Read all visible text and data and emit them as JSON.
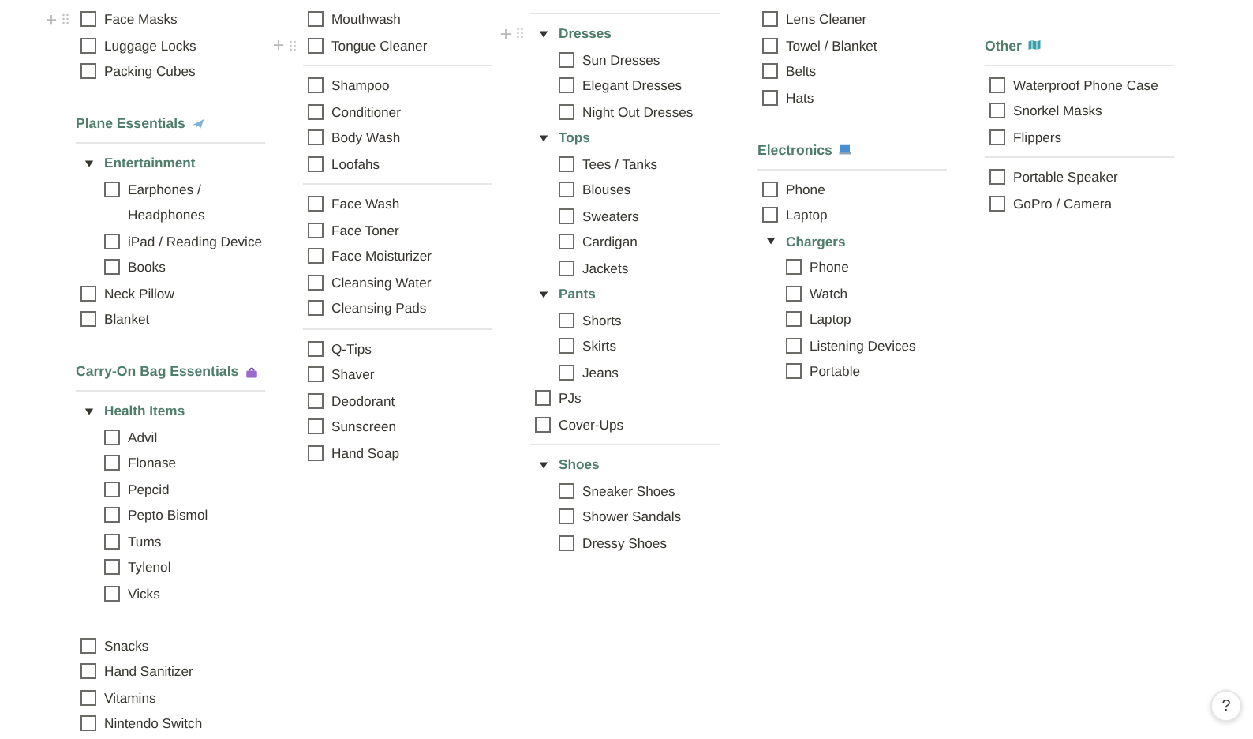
{
  "columns": [
    {
      "blocks": [
        {
          "kind": "todo",
          "text": "Face Masks",
          "checked": false,
          "hovered": true
        },
        {
          "kind": "todo",
          "text": "Luggage Locks",
          "checked": false
        },
        {
          "kind": "todo",
          "text": "Packing Cubes",
          "checked": false
        },
        {
          "kind": "spacer"
        },
        {
          "kind": "heading",
          "text": "Plane Essentials"
        },
        {
          "kind": "divider"
        },
        {
          "kind": "toggle",
          "text": "Entertainment",
          "expanded": true,
          "children": [
            {
              "text": "Earphones /\nHeadphones",
              "checked": false
            },
            {
              "text": "iPad / Reading Device",
              "checked": false
            },
            {
              "text": "Books",
              "checked": false
            }
          ]
        },
        {
          "kind": "todo",
          "text": "Neck Pillow",
          "checked": false
        },
        {
          "kind": "todo",
          "text": "Blanket",
          "checked": false
        },
        {
          "kind": "spacer"
        },
        {
          "kind": "heading",
          "text": "Carry-On Bag Essentials"
        },
        {
          "kind": "divider"
        },
        {
          "kind": "toggle",
          "text": "Health Items",
          "expanded": true,
          "children": [
            {
              "text": "Advil",
              "checked": false
            },
            {
              "text": "Flonase",
              "checked": false
            },
            {
              "text": "Pepcid",
              "checked": false
            },
            {
              "text": "Pepto Bismol",
              "checked": false
            },
            {
              "text": "Tums",
              "checked": false
            },
            {
              "text": "Tylenol",
              "checked": false
            },
            {
              "text": "Vicks",
              "checked": false
            }
          ]
        },
        {
          "kind": "spacer"
        },
        {
          "kind": "todo",
          "text": "Snacks",
          "checked": false
        },
        {
          "kind": "todo",
          "text": "Hand Sanitizer",
          "checked": false
        },
        {
          "kind": "todo",
          "text": "Vitamins",
          "checked": false
        },
        {
          "kind": "todo",
          "text": "Nintendo Switch",
          "checked": false
        }
      ]
    },
    {
      "blocks": [
        {
          "kind": "todo",
          "text": "Mouthwash",
          "checked": false
        },
        {
          "kind": "todo",
          "text": "Tongue Cleaner",
          "checked": false,
          "hovered": true
        },
        {
          "kind": "divider"
        },
        {
          "kind": "todo",
          "text": "Shampoo",
          "checked": false
        },
        {
          "kind": "todo",
          "text": "Conditioner",
          "checked": false
        },
        {
          "kind": "todo",
          "text": "Body Wash",
          "checked": false
        },
        {
          "kind": "todo",
          "text": "Loofahs",
          "checked": false
        },
        {
          "kind": "divider"
        },
        {
          "kind": "todo",
          "text": "Face Wash",
          "checked": false
        },
        {
          "kind": "todo",
          "text": "Face Toner",
          "checked": false
        },
        {
          "kind": "todo",
          "text": "Face Moisturizer",
          "checked": false
        },
        {
          "kind": "todo",
          "text": "Cleansing Water",
          "checked": false
        },
        {
          "kind": "todo",
          "text": "Cleansing Pads",
          "checked": false
        },
        {
          "kind": "divider"
        },
        {
          "kind": "todo",
          "text": "Q-Tips",
          "checked": false
        },
        {
          "kind": "todo",
          "text": "Shaver",
          "checked": false
        },
        {
          "kind": "todo",
          "text": "Deodorant",
          "checked": false
        },
        {
          "kind": "todo",
          "text": "Sunscreen",
          "checked": false
        },
        {
          "kind": "todo",
          "text": "Hand Soap",
          "checked": false
        }
      ]
    },
    {
      "blocks": [
        {
          "kind": "divider"
        },
        {
          "kind": "toggle",
          "text": "Dresses",
          "expanded": true,
          "hovered": true,
          "children": [
            {
              "text": "Sun Dresses",
              "checked": false
            },
            {
              "text": "Elegant Dresses",
              "checked": false
            },
            {
              "text": "Night Out Dresses",
              "checked": false
            }
          ]
        },
        {
          "kind": "toggle",
          "text": "Tops",
          "expanded": true,
          "children": [
            {
              "text": "Tees / Tanks",
              "checked": false
            },
            {
              "text": "Blouses",
              "checked": false
            },
            {
              "text": "Sweaters",
              "checked": false
            },
            {
              "text": "Cardigan",
              "checked": false
            },
            {
              "text": "Jackets",
              "checked": false
            }
          ]
        },
        {
          "kind": "toggle",
          "text": "Pants",
          "expanded": true,
          "children": [
            {
              "text": "Shorts",
              "checked": false
            },
            {
              "text": "Skirts",
              "checked": false
            },
            {
              "text": "Jeans",
              "checked": false
            }
          ]
        },
        {
          "kind": "todo",
          "text": "PJs",
          "checked": false
        },
        {
          "kind": "todo",
          "text": "Cover-Ups",
          "checked": false
        },
        {
          "kind": "divider"
        },
        {
          "kind": "toggle",
          "text": "Shoes",
          "expanded": true,
          "children": [
            {
              "text": "Sneaker Shoes",
              "checked": false
            },
            {
              "text": "Shower Sandals",
              "checked": false
            },
            {
              "text": "Dressy Shoes",
              "checked": false
            }
          ]
        }
      ]
    },
    {
      "blocks": [
        {
          "kind": "todo",
          "text": "Lens Cleaner",
          "checked": false
        },
        {
          "kind": "todo",
          "text": "Towel / Blanket",
          "checked": false
        },
        {
          "kind": "todo",
          "text": "Belts",
          "checked": false
        },
        {
          "kind": "todo",
          "text": "Hats",
          "checked": false
        },
        {
          "kind": "spacer"
        },
        {
          "kind": "heading",
          "text": "Electronics"
        },
        {
          "kind": "divider"
        },
        {
          "kind": "todo",
          "text": "Phone",
          "checked": false
        },
        {
          "kind": "todo",
          "text": "Laptop",
          "checked": false
        },
        {
          "kind": "toggle",
          "text": "Chargers",
          "expanded": true,
          "children": [
            {
              "text": "Phone",
              "checked": false
            },
            {
              "text": "Watch",
              "checked": false
            },
            {
              "text": "Laptop",
              "checked": false
            },
            {
              "text": "Listening Devices",
              "checked": false
            },
            {
              "text": "Portable",
              "checked": false
            }
          ]
        }
      ]
    },
    {
      "blocks": [
        {
          "kind": "spacer"
        },
        {
          "kind": "heading",
          "text": "Other"
        },
        {
          "kind": "divider"
        },
        {
          "kind": "todo",
          "text": "Waterproof Phone Case",
          "checked": false
        },
        {
          "kind": "todo",
          "text": "Snorkel Masks",
          "checked": false
        },
        {
          "kind": "todo",
          "text": "Flippers",
          "checked": false
        },
        {
          "kind": "divider"
        },
        {
          "kind": "todo",
          "text": "Portable Speaker",
          "checked": false
        },
        {
          "kind": "todo",
          "text": "GoPro / Camera",
          "checked": false
        }
      ]
    }
  ],
  "help_button": {
    "label": "?"
  }
}
